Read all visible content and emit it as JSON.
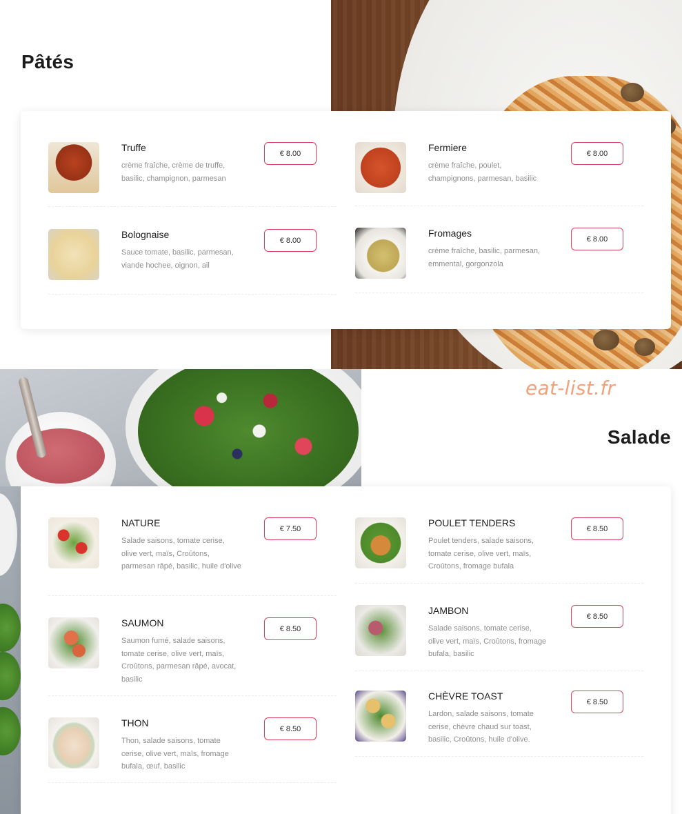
{
  "pates": {
    "title": "Pâtés",
    "items": [
      {
        "name": "Truffe",
        "desc": "crème fraîche, crème de truffe, basilic, champignon, parmesan",
        "price": "€ 8.00"
      },
      {
        "name": "Fermiere",
        "desc": "crème fraîche, poulet, champignons, parmesan, basilic",
        "price": "€ 8.00"
      },
      {
        "name": "Bolognaise",
        "desc": "Sauce tomate, basilic, parmesan, viande hochee, oignon, ail",
        "price": "€ 8.00"
      },
      {
        "name": "Fromages",
        "desc": "crème fraîche, basilic, parmesan, emmental, gorgonzola",
        "price": "€ 8.00"
      }
    ]
  },
  "watermark": "eat-list.fr",
  "salade": {
    "title": "Salade",
    "items": [
      {
        "name": "NATURE",
        "desc": "Salade saisons, tomate cerise, olive vert, maïs, Croûtons, parmesan râpé, basilic, huile d'olive",
        "price": "€ 7.50"
      },
      {
        "name": "POULET TENDERS",
        "desc": "Poulet tenders, salade saisons, tomate cerise, olive vert, maïs, Croûtons, fromage bufala",
        "price": "€ 8.50"
      },
      {
        "name": "SAUMON",
        "desc": "Saumon fumé, salade saisons, tomate cerise, olive vert, maïs, Croûtons, parmesan râpé, avocat, basilic",
        "price": "€ 8.50"
      },
      {
        "name": "JAMBON",
        "desc": "Salade saisons, tomate cerise, olive vert, maïs, Croûtons, fromage bufala, basilic",
        "price": "€ 8.50"
      },
      {
        "name": "THON",
        "desc": "Thon, salade saisons, tomate cerise, olive vert, maïs, fromage bufala, œuf, basilic",
        "price": "€ 8.50"
      },
      {
        "name": "CHÈVRE TOAST",
        "desc": "Lardon, salade saisons, tomate cerise, chèvre chaud sur toast, basilic, Croûtons, huile d'olive.",
        "price": "€ 8.50"
      }
    ]
  }
}
